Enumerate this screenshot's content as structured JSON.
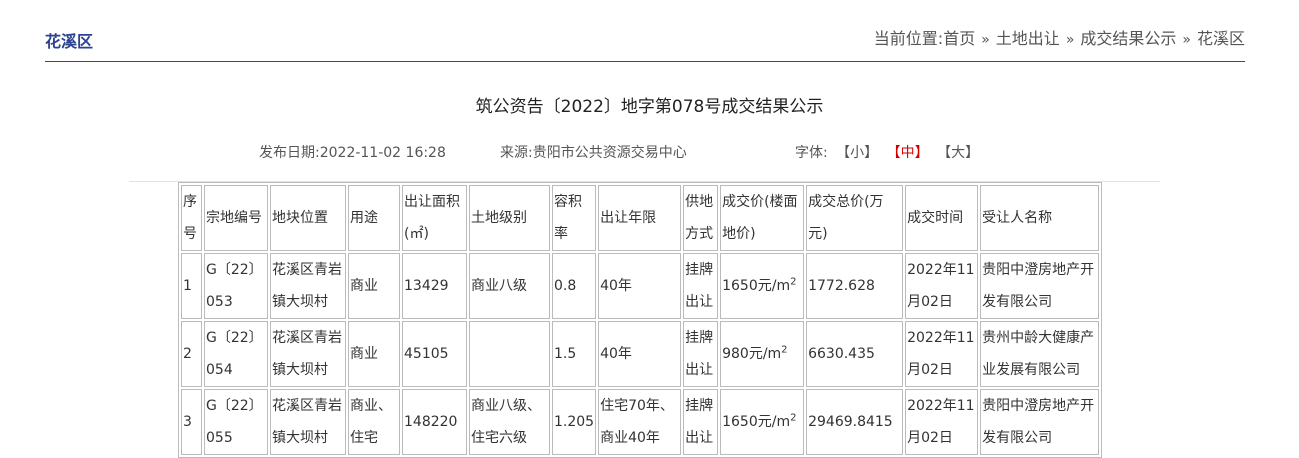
{
  "header": {
    "section_title": "花溪区",
    "breadcrumb_prefix": "当前位置:",
    "breadcrumb": [
      "首页",
      "土地出让",
      "成交结果公示",
      "花溪区"
    ],
    "separator": "»"
  },
  "document": {
    "title": "筑公资告〔2022〕地字第078号成交结果公示",
    "publish_label": "发布日期:",
    "publish_date": "2022-11-02 16:28",
    "source_label": "来源:",
    "source": "贵阳市公共资源交易中心",
    "font_size_label": "字体:",
    "font_sizes": [
      "【小】",
      "【中】",
      "【大】"
    ],
    "active_font_size": "【中】"
  },
  "table": {
    "headers": [
      "序号",
      "宗地编号",
      "地块位置",
      "用途",
      "出让面积(㎡)",
      "土地级别",
      "容积率",
      "出让年限",
      "供地方式",
      "成交价(楼面地价)",
      "成交总价(万元)",
      "成交时间",
      "受让人名称"
    ],
    "rows": [
      {
        "no": "1",
        "code": "G〔22〕053",
        "location": "花溪区青岩镇大坝村",
        "use": "商业",
        "area": "13429",
        "grade": "商业八级",
        "far": "0.8",
        "term": "40年",
        "method": "挂牌出让",
        "unit_price": "1650元/m",
        "unit_sup": "2",
        "total": "1772.628",
        "date": "2022年11月02日",
        "buyer": "贵阳中澄房地产开发有限公司"
      },
      {
        "no": "2",
        "code": "G〔22〕054",
        "location": "花溪区青岩镇大坝村",
        "use": "商业",
        "area": "45105",
        "grade": "",
        "far": "1.5",
        "term": "40年",
        "method": "挂牌出让",
        "unit_price": "980元/m",
        "unit_sup": "2",
        "total": "6630.435",
        "date": "2022年11月02日",
        "buyer": "贵州中龄大健康产业发展有限公司"
      },
      {
        "no": "3",
        "code": "G〔22〕055",
        "location": "花溪区青岩镇大坝村",
        "use": "商业、住宅",
        "area": "148220",
        "grade": "商业八级、住宅六级",
        "far": "1.205",
        "term": "住宅70年、商业40年",
        "method": "挂牌出让",
        "unit_price": "1650元/m",
        "unit_sup": "2",
        "total": "29469.8415",
        "date": "2022年11月02日",
        "buyer": "贵阳中澄房地产开发有限公司"
      }
    ]
  }
}
